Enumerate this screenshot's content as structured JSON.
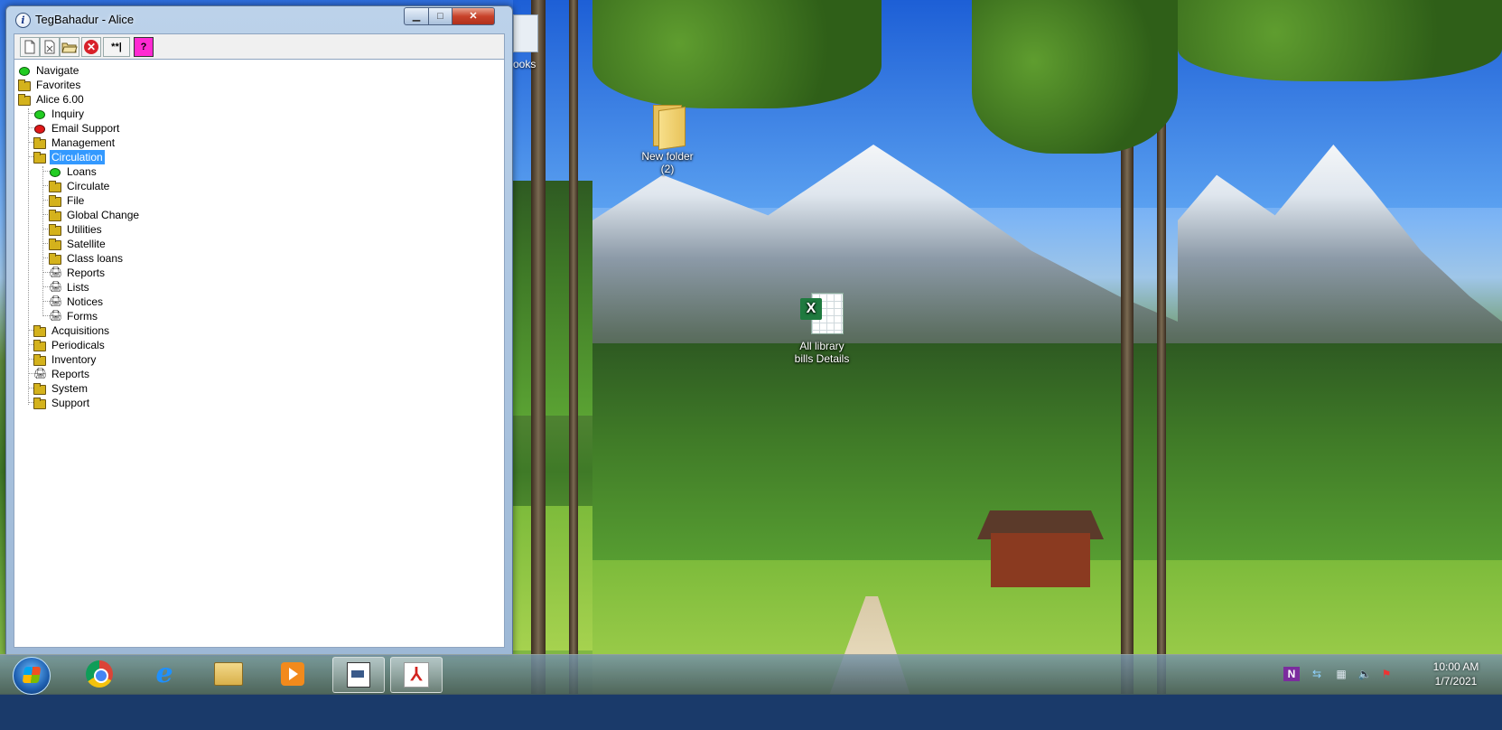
{
  "window": {
    "title": "TegBahadur - Alice",
    "controls": {
      "minimize": "▁",
      "maximize": "□",
      "close": "✕"
    }
  },
  "toolbar": {
    "buttons": [
      {
        "icon": "new-document-icon",
        "label": ""
      },
      {
        "icon": "delete-document-icon",
        "label": ""
      },
      {
        "icon": "open-folder-icon",
        "label": ""
      },
      {
        "icon": "stop-icon",
        "label": "✕"
      },
      {
        "icon": "password-icon",
        "label": "**|"
      },
      {
        "icon": "help-icon",
        "label": "?"
      }
    ]
  },
  "tree": {
    "nodes": [
      {
        "label": "Navigate",
        "icon": "green-dot"
      },
      {
        "label": "Favorites",
        "icon": "folder"
      },
      {
        "label": "Alice 6.00",
        "icon": "folder"
      },
      {
        "label": "Inquiry",
        "icon": "green-dot"
      },
      {
        "label": "Email Support",
        "icon": "red-dot"
      },
      {
        "label": "Management",
        "icon": "folder"
      },
      {
        "label": "Circulation",
        "icon": "folder",
        "selected": true
      },
      {
        "label": "Loans",
        "icon": "green-dot"
      },
      {
        "label": "Circulate",
        "icon": "folder"
      },
      {
        "label": "File",
        "icon": "folder"
      },
      {
        "label": "Global Change",
        "icon": "folder"
      },
      {
        "label": "Utilities",
        "icon": "folder"
      },
      {
        "label": "Satellite",
        "icon": "folder"
      },
      {
        "label": "Class loans",
        "icon": "folder"
      },
      {
        "label": "Reports",
        "icon": "printer"
      },
      {
        "label": "Lists",
        "icon": "printer"
      },
      {
        "label": "Notices",
        "icon": "printer"
      },
      {
        "label": "Forms",
        "icon": "printer"
      },
      {
        "label": "Acquisitions",
        "icon": "folder"
      },
      {
        "label": "Periodicals",
        "icon": "folder"
      },
      {
        "label": "Inventory",
        "icon": "folder"
      },
      {
        "label": "Reports",
        "icon": "printer"
      },
      {
        "label": "System",
        "icon": "folder"
      },
      {
        "label": "Support",
        "icon": "folder"
      }
    ]
  },
  "desktop": {
    "partial_icon_label": "ooks",
    "new_folder": {
      "line1": "New folder",
      "line2": "(2)"
    },
    "excel_file": {
      "line1": "All library",
      "line2": "bills Details"
    }
  },
  "taskbar": {
    "apps": [
      "start",
      "chrome",
      "internet-explorer",
      "file-explorer",
      "media-player",
      "alice",
      "acrobat-reader"
    ],
    "active_app": "alice",
    "tray": {
      "onenote": "N",
      "network_alt": "⇆",
      "network": "▦",
      "volume": "🔈",
      "flag": "⚑"
    },
    "clock_time": "10:00 AM",
    "clock_date": "1/7/2021"
  }
}
